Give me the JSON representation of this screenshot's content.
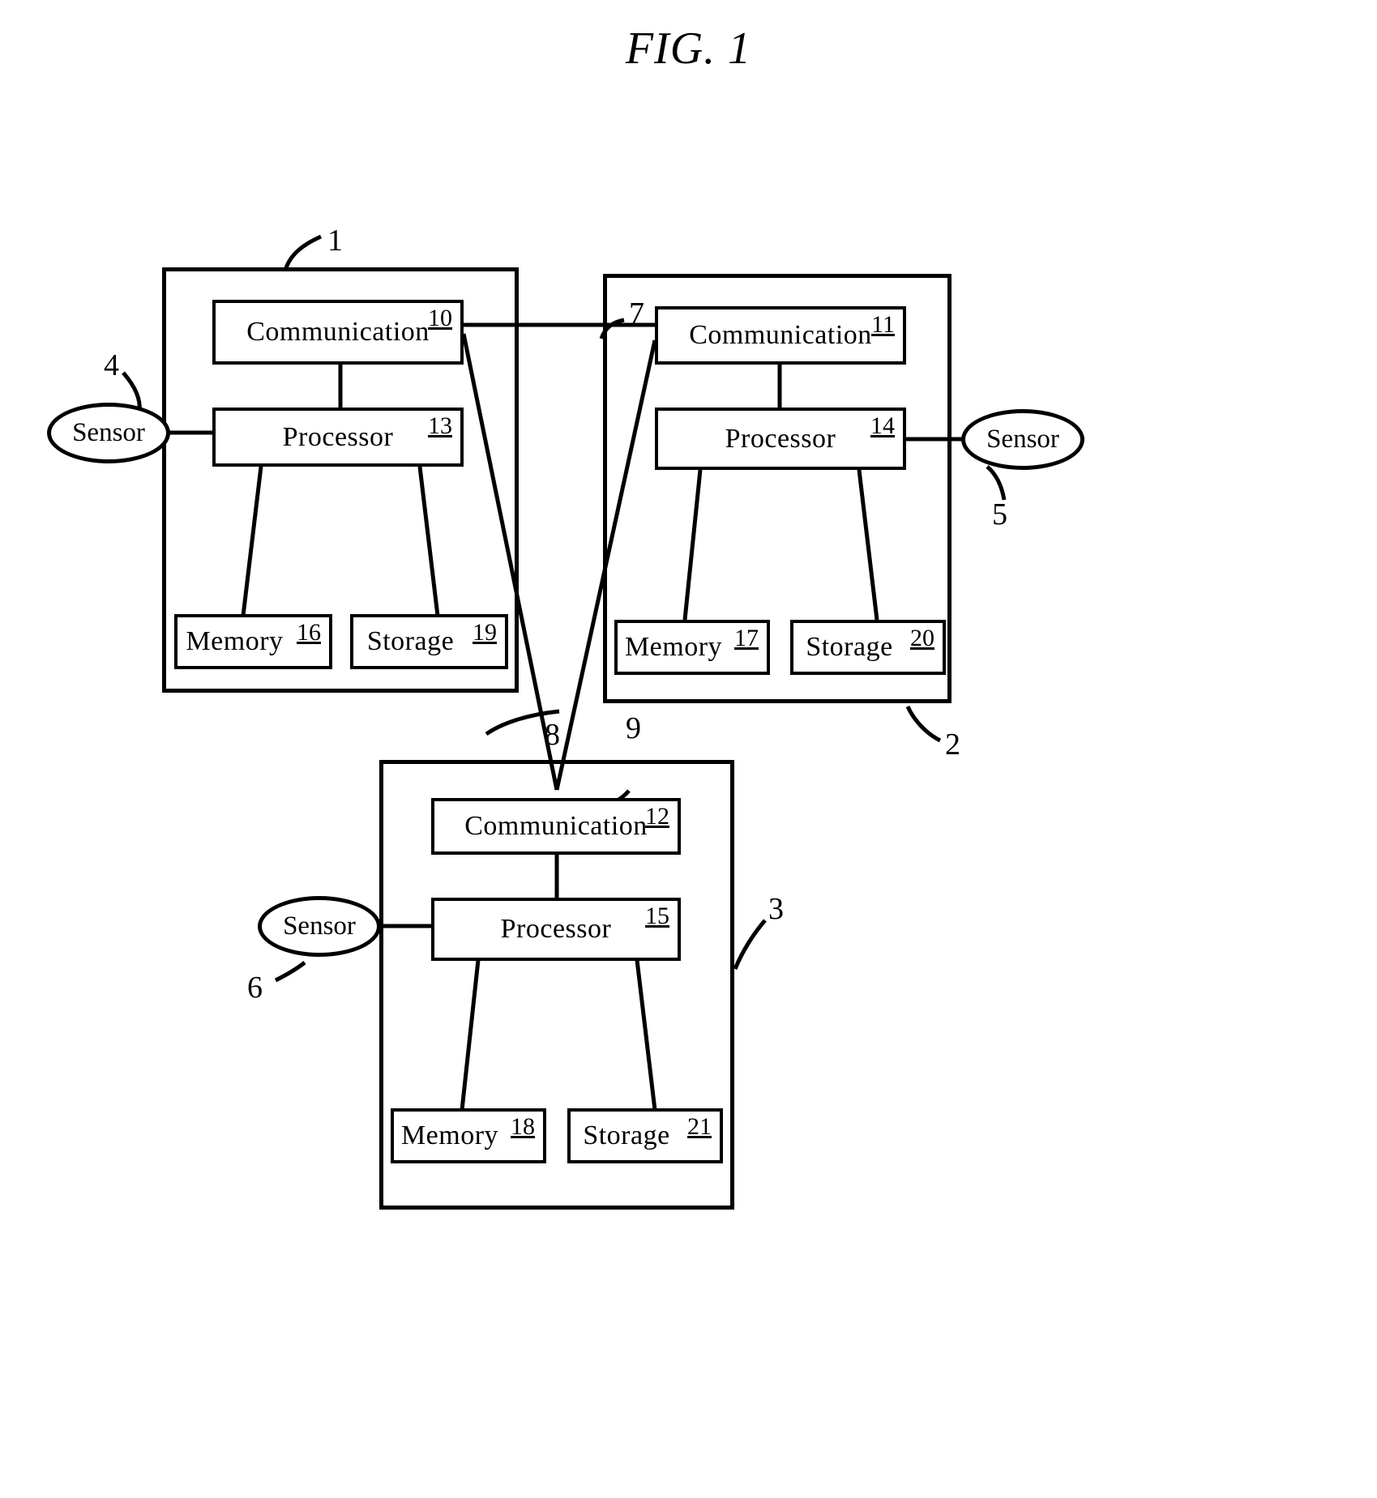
{
  "figure": {
    "title": "FIG. 1",
    "type": "patent-block-diagram"
  },
  "nodes": [
    {
      "id": "node-1",
      "ref": "1",
      "units": [
        {
          "key": "communication",
          "label": "Communication",
          "num": "10"
        },
        {
          "key": "processor",
          "label": "Processor",
          "num": "13"
        },
        {
          "key": "memory",
          "label": "Memory",
          "num": "16"
        },
        {
          "key": "storage",
          "label": "Storage",
          "num": "19"
        }
      ],
      "sensor": {
        "label": "Sensor",
        "ref": "4"
      }
    },
    {
      "id": "node-2",
      "ref": "2",
      "units": [
        {
          "key": "communication",
          "label": "Communication",
          "num": "11"
        },
        {
          "key": "processor",
          "label": "Processor",
          "num": "14"
        },
        {
          "key": "memory",
          "label": "Memory",
          "num": "17"
        },
        {
          "key": "storage",
          "label": "Storage",
          "num": "20"
        }
      ],
      "sensor": {
        "label": "Sensor",
        "ref": "5"
      }
    },
    {
      "id": "node-3",
      "ref": "3",
      "units": [
        {
          "key": "communication",
          "label": "Communication",
          "num": "12"
        },
        {
          "key": "processor",
          "label": "Processor",
          "num": "15"
        },
        {
          "key": "memory",
          "label": "Memory",
          "num": "18"
        },
        {
          "key": "storage",
          "label": "Storage",
          "num": "21"
        }
      ],
      "sensor": {
        "label": "Sensor",
        "ref": "6"
      }
    }
  ],
  "links": [
    {
      "id": "link-7",
      "ref": "7",
      "from": "communication-10",
      "to": "communication-11"
    },
    {
      "id": "link-8",
      "ref": "8",
      "from": "communication-10",
      "to": "communication-12"
    },
    {
      "id": "link-9",
      "ref": "9",
      "from": "communication-11",
      "to": "communication-12"
    }
  ],
  "colors": {
    "line": "#000000",
    "background": "#ffffff"
  }
}
